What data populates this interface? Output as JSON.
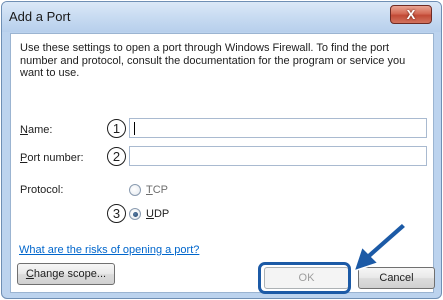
{
  "window": {
    "title": "Add a Port",
    "close_label": "X"
  },
  "intro": "Use these settings to open a port through Windows Firewall. To find the port number and protocol, consult the documentation for the program or service you want to use.",
  "fields": {
    "name_label_prefix": "N",
    "name_label_rest": "ame:",
    "name_value": "",
    "port_label_prefix": "P",
    "port_label_rest": "ort number:",
    "port_value": "",
    "protocol_label": "Protocol:"
  },
  "callouts": [
    "1",
    "2",
    "3"
  ],
  "protocol": {
    "tcp_prefix": "T",
    "tcp_rest": "CP",
    "udp_prefix": "U",
    "udp_rest": "DP",
    "selected": "UDP"
  },
  "link": "What are the risks of opening a port?",
  "buttons": {
    "change_scope_prefix": "C",
    "change_scope_rest": "hange scope...",
    "ok": "OK",
    "cancel": "Cancel"
  },
  "colors": {
    "highlight": "#1c5aa6",
    "link": "#0066cc"
  },
  "icons": [
    "close-icon",
    "arrow-pointer-icon"
  ]
}
